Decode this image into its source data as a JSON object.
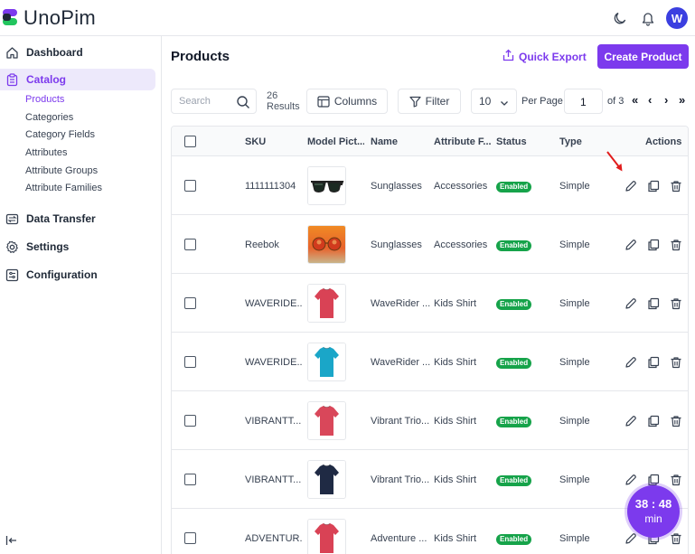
{
  "app": {
    "name": "UnoPim",
    "avatar_initial": "W",
    "brand_color": "#7c3aed"
  },
  "sidebar": {
    "items": [
      {
        "label": "Dashboard",
        "icon": "home-icon"
      },
      {
        "label": "Catalog",
        "icon": "clipboard-icon",
        "active": true
      },
      {
        "label": "Data Transfer",
        "icon": "transfer-icon"
      },
      {
        "label": "Settings",
        "icon": "gear-icon"
      },
      {
        "label": "Configuration",
        "icon": "sliders-icon"
      }
    ],
    "catalog_subitems": [
      "Products",
      "Categories",
      "Category Fields",
      "Attributes",
      "Attribute Groups",
      "Attribute Families"
    ]
  },
  "page": {
    "title": "Products",
    "quick_export": "Quick Export",
    "create_button": "Create Product"
  },
  "toolbar": {
    "search_placeholder": "Search",
    "results_count": "26",
    "results_label": "Results",
    "columns_label": "Columns",
    "filter_label": "Filter",
    "per_page_value": "10",
    "per_page_label": "Per Page",
    "current_page": "1",
    "of_pages": "of 3"
  },
  "table": {
    "headers": [
      "SKU",
      "Model Pict...",
      "Name",
      "Attribute F...",
      "Status",
      "Type",
      "Actions"
    ],
    "rows": [
      {
        "sku": "1111111304",
        "name": "Sunglasses",
        "family": "Accessories",
        "status": "Enabled",
        "type": "Simple",
        "image": "sunglasses-black"
      },
      {
        "sku": "Reebok",
        "name": "Sunglasses",
        "family": "Accessories",
        "status": "Enabled",
        "type": "Simple",
        "image": "sunglasses-orange"
      },
      {
        "sku": "WAVERIDE...",
        "name": "WaveRider ...",
        "family": "Kids Shirt",
        "status": "Enabled",
        "type": "Simple",
        "image": "shirt-red",
        "color": "#d94255"
      },
      {
        "sku": "WAVERIDE...",
        "name": "WaveRider ...",
        "family": "Kids Shirt",
        "status": "Enabled",
        "type": "Simple",
        "image": "shirt-cyan",
        "color": "#1aa6c8"
      },
      {
        "sku": "VIBRANTT...",
        "name": "Vibrant Trio...",
        "family": "Kids Shirt",
        "status": "Enabled",
        "type": "Simple",
        "image": "shirt-red",
        "color": "#d9475a"
      },
      {
        "sku": "VIBRANTT...",
        "name": "Vibrant Trio...",
        "family": "Kids Shirt",
        "status": "Enabled",
        "type": "Simple",
        "image": "shirt-navy",
        "color": "#1f2a44"
      },
      {
        "sku": "ADVENTUR...",
        "name": "Adventure ...",
        "family": "Kids Shirt",
        "status": "Enabled",
        "type": "Simple",
        "image": "shirt-red",
        "color": "#d94255"
      }
    ]
  },
  "timer": {
    "time": "38 : 48",
    "unit": "min"
  }
}
